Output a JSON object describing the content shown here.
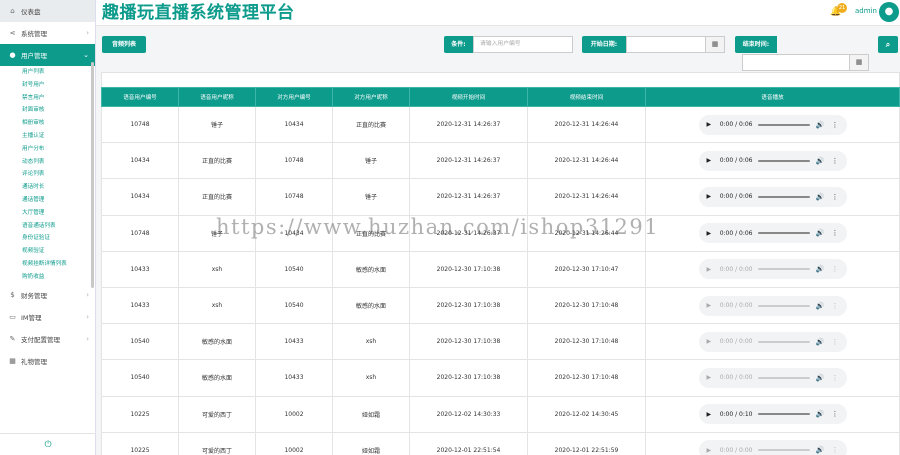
{
  "header": {
    "title": "趣播玩直播系统管理平台",
    "notification_count": "21",
    "admin_name": "admin"
  },
  "sidebar": {
    "home": "仪表盘",
    "system": "系统管理",
    "user": "用户管理",
    "sub_items": [
      "用户列表",
      "封号用户",
      "禁言用户",
      "封面审核",
      "相册审核",
      "主播认证",
      "用户分布",
      "动态列表",
      "评论列表",
      "通话时长",
      "通话管理",
      "大厅管理",
      "语音通话列表",
      "身份证验证",
      "视频验证",
      "视频挂断详情列表",
      "购奶收益"
    ],
    "finance": "财务管理",
    "im": "IM管理",
    "pay_config": "支付配置管理",
    "gift": "礼物管理"
  },
  "toolbar": {
    "list_button": "音频列表",
    "condition_label": "条件:",
    "condition_placeholder": "请输入用户编号",
    "start_label": "开始日期:",
    "end_label": "结束时间:"
  },
  "table": {
    "headers": [
      "语音用户编号",
      "语音用户昵称",
      "对方用户编号",
      "对方用户昵称",
      "视频开始时间",
      "视频结束时间",
      "语音播放"
    ],
    "rows": [
      {
        "uid": "10748",
        "uname": "锤子",
        "oid": "10434",
        "oname": "正直的比赛",
        "start": "2020-12-31 14:26:37",
        "end": "2020-12-31 14:26:44",
        "time": "0:00 / 0:06",
        "active": true
      },
      {
        "uid": "10434",
        "uname": "正直的比赛",
        "oid": "10748",
        "oname": "锤子",
        "start": "2020-12-31 14:26:37",
        "end": "2020-12-31 14:26:44",
        "time": "0:00 / 0:06",
        "active": true
      },
      {
        "uid": "10434",
        "uname": "正直的比赛",
        "oid": "10748",
        "oname": "锤子",
        "start": "2020-12-31 14:26:37",
        "end": "2020-12-31 14:26:44",
        "time": "0:00 / 0:06",
        "active": true
      },
      {
        "uid": "10748",
        "uname": "锤子",
        "oid": "10434",
        "oname": "正直的比赛",
        "start": "2020-12-31 14:26:37",
        "end": "2020-12-31 14:26:44",
        "time": "0:00 / 0:06",
        "active": true
      },
      {
        "uid": "10433",
        "uname": "xsh",
        "oid": "10540",
        "oname": "敏感的水面",
        "start": "2020-12-30 17:10:38",
        "end": "2020-12-30 17:10:47",
        "time": "0:00 / 0:00",
        "active": false
      },
      {
        "uid": "10433",
        "uname": "xsh",
        "oid": "10540",
        "oname": "敏感的水面",
        "start": "2020-12-30 17:10:38",
        "end": "2020-12-30 17:10:48",
        "time": "0:00 / 0:00",
        "active": false
      },
      {
        "uid": "10540",
        "uname": "敏感的水面",
        "oid": "10433",
        "oname": "xsh",
        "start": "2020-12-30 17:10:38",
        "end": "2020-12-30 17:10:48",
        "time": "0:00 / 0:00",
        "active": false
      },
      {
        "uid": "10540",
        "uname": "敏感的水面",
        "oid": "10433",
        "oname": "xsh",
        "start": "2020-12-30 17:10:38",
        "end": "2020-12-30 17:10:48",
        "time": "0:00 / 0:00",
        "active": false
      },
      {
        "uid": "10225",
        "uname": "可爱的西丁",
        "oid": "10002",
        "oname": "娅如霜",
        "start": "2020-12-02 14:30:33",
        "end": "2020-12-02 14:30:45",
        "time": "0:00 / 0:10",
        "active": true
      },
      {
        "uid": "10225",
        "uname": "可爱的西丁",
        "oid": "10002",
        "oname": "娅如霜",
        "start": "2020-12-01 22:51:54",
        "end": "2020-12-01 22:51:59",
        "time": "0:00 / 0:00",
        "active": false
      }
    ]
  },
  "watermark": "https://www.huzhan.com/ishop31291",
  "colors": {
    "accent": "#0d9b8c",
    "badge": "#f0ad1e"
  }
}
